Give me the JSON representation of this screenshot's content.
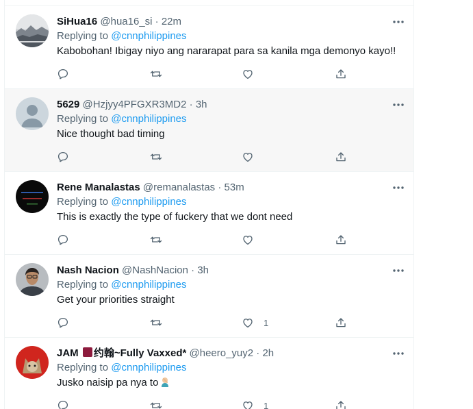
{
  "colors": {
    "link": "#1d9bf0",
    "muted": "#536471",
    "text": "#0f1419",
    "border": "#eff3f4",
    "hover_bg": "#f7f7f7"
  },
  "tweets": [
    {
      "name": "SiHua16",
      "handle": "@hua16_si",
      "sep": "·",
      "time": "22m",
      "replying_prefix": "Replying to",
      "replying_to": "@cnnphilippines",
      "text": "Kabobohan! Ibigay niyo ang nararapat para sa kanila mga demonyo kayo!!",
      "like_count": "",
      "avatar": "landscape-photo"
    },
    {
      "name": "5629",
      "handle": "@Hzjyy4PFGXR3MD2",
      "sep": "·",
      "time": "3h",
      "replying_prefix": "Replying to",
      "replying_to": "@cnnphilippines",
      "text": "Nice thought bad timing",
      "like_count": "",
      "avatar": "default-avatar"
    },
    {
      "name": "Rene Manalastas",
      "handle": "@remanalastas",
      "sep": "·",
      "time": "53m",
      "replying_prefix": "Replying to",
      "replying_to": "@cnnphilippines",
      "text": "This is exactly the type of fuckery that we dont need",
      "like_count": "",
      "avatar": "dark-logo"
    },
    {
      "name": "Nash Nacion",
      "handle": "@NashNacion",
      "sep": "·",
      "time": "3h",
      "replying_prefix": "Replying to",
      "replying_to": "@cnnphilippines",
      "text": "Get your priorities straight",
      "like_count": "1",
      "avatar": "person-photo"
    },
    {
      "name_before_flag": "JAM",
      "name": "约翰~Fully Vaxxed*",
      "handle": "@heero_yuy2",
      "sep": "·",
      "time": "2h",
      "replying_prefix": "Replying to",
      "replying_to": "@cnnphilippines",
      "text": "Jusko naisip pa nya to",
      "like_count": "1",
      "avatar": "lynx-photo"
    }
  ]
}
